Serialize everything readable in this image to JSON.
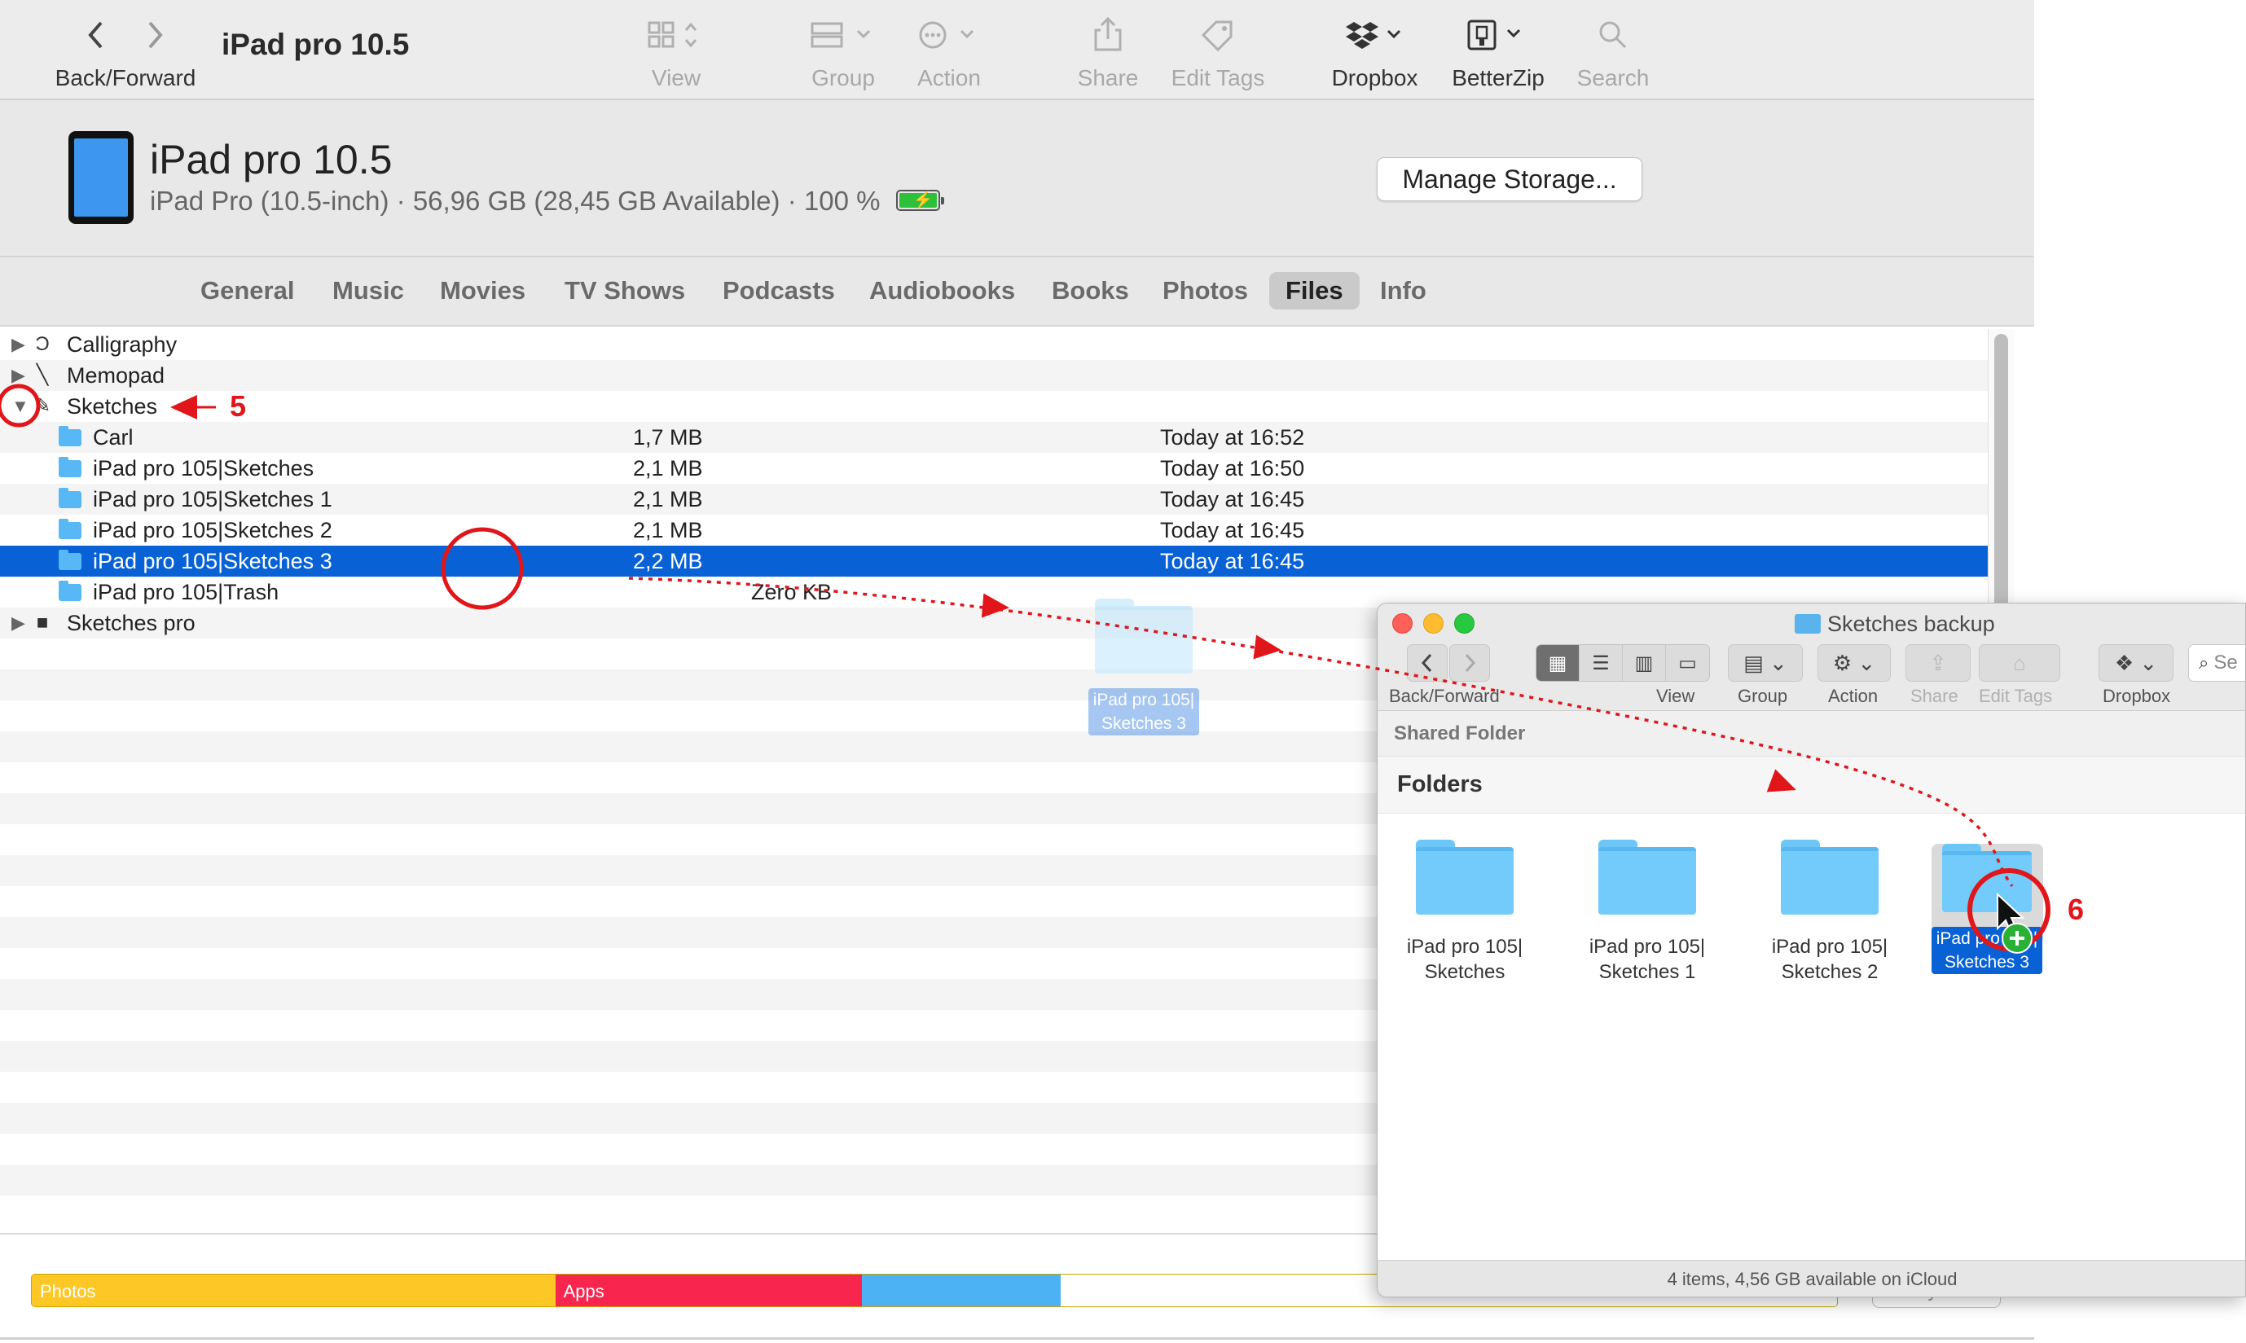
{
  "window": {
    "title": "iPad pro 10.5"
  },
  "toolbar": {
    "back_forward": "Back/Forward",
    "view": "View",
    "group": "Group",
    "action": "Action",
    "share": "Share",
    "edit_tags": "Edit Tags",
    "dropbox": "Dropbox",
    "betterzip": "BetterZip",
    "search": "Search"
  },
  "device": {
    "name": "iPad pro 10.5",
    "model": "iPad Pro (10.5-inch)",
    "capacity": "56,96 GB (28,45 GB Available)",
    "battery": "100 %",
    "manage_storage": "Manage Storage..."
  },
  "tabs": [
    "General",
    "Music",
    "Movies",
    "TV Shows",
    "Podcasts",
    "Audiobooks",
    "Books",
    "Photos",
    "Files",
    "Info"
  ],
  "selected_tab": "Files",
  "file_list": [
    {
      "name": "Calligraphy",
      "icon": "calligraphy-app-icon",
      "expandable": true,
      "expanded": false
    },
    {
      "name": "Memopad",
      "icon": "memopad-app-icon",
      "expandable": true,
      "expanded": false
    },
    {
      "name": "Sketches",
      "icon": "sketches-app-icon",
      "expandable": true,
      "expanded": true
    },
    {
      "name": "Carl",
      "size": "1,7 MB",
      "date": "Today at 16:52",
      "child": true
    },
    {
      "name": "iPad pro 105|Sketches",
      "size": "2,1 MB",
      "date": "Today at 16:50",
      "child": true
    },
    {
      "name": "iPad pro 105|Sketches 1",
      "size": "2,1 MB",
      "date": "Today at 16:45",
      "child": true
    },
    {
      "name": "iPad pro 105|Sketches 2",
      "size": "2,1 MB",
      "date": "Today at 16:45",
      "child": true
    },
    {
      "name": "iPad pro 105|Sketches 3",
      "size": "2,2 MB",
      "date": "Today at 16:45",
      "child": true,
      "selected": true
    },
    {
      "name": "iPad pro 105|Trash",
      "size": "Zero KB",
      "date": "",
      "child": true
    },
    {
      "name": "Sketches pro",
      "icon": "sketches-pro-app-icon",
      "expandable": true,
      "expanded": false
    }
  ],
  "storage_bar": {
    "segments": [
      {
        "label": "Photos",
        "color": "#fdc825",
        "fraction": 0.29
      },
      {
        "label": "Apps",
        "color": "#f8264f",
        "fraction": 0.17
      },
      {
        "label": "",
        "color": "#4db2f4",
        "fraction": 0.11
      },
      {
        "label": "",
        "color": "#ffffff",
        "fraction": 0.43
      }
    ],
    "sync_label": "Sync"
  },
  "drag_ghost": {
    "label_line1": "iPad pro 105|",
    "label_line2": "Sketches 3"
  },
  "finder": {
    "title": "Sketches backup",
    "toolbar": {
      "back_forward": "Back/Forward",
      "view": "View",
      "group": "Group",
      "action": "Action",
      "share": "Share",
      "edit_tags": "Edit Tags",
      "dropbox": "Dropbox",
      "search_placeholder": "Se"
    },
    "section_shared": "Shared Folder",
    "section_folders": "Folders",
    "items": [
      {
        "line1": "iPad pro 105|",
        "line2": "Sketches"
      },
      {
        "line1": "iPad pro 105|",
        "line2": "Sketches 1"
      },
      {
        "line1": "iPad pro 105|",
        "line2": "Sketches 2"
      },
      {
        "line1": "iPad pro 105|",
        "line2": "Sketches 3",
        "selected": true
      }
    ],
    "status": "4 items, 4,56 GB available on iCloud"
  },
  "annotations": {
    "step5": "5",
    "step6": "6",
    "color": "#e0161a"
  }
}
